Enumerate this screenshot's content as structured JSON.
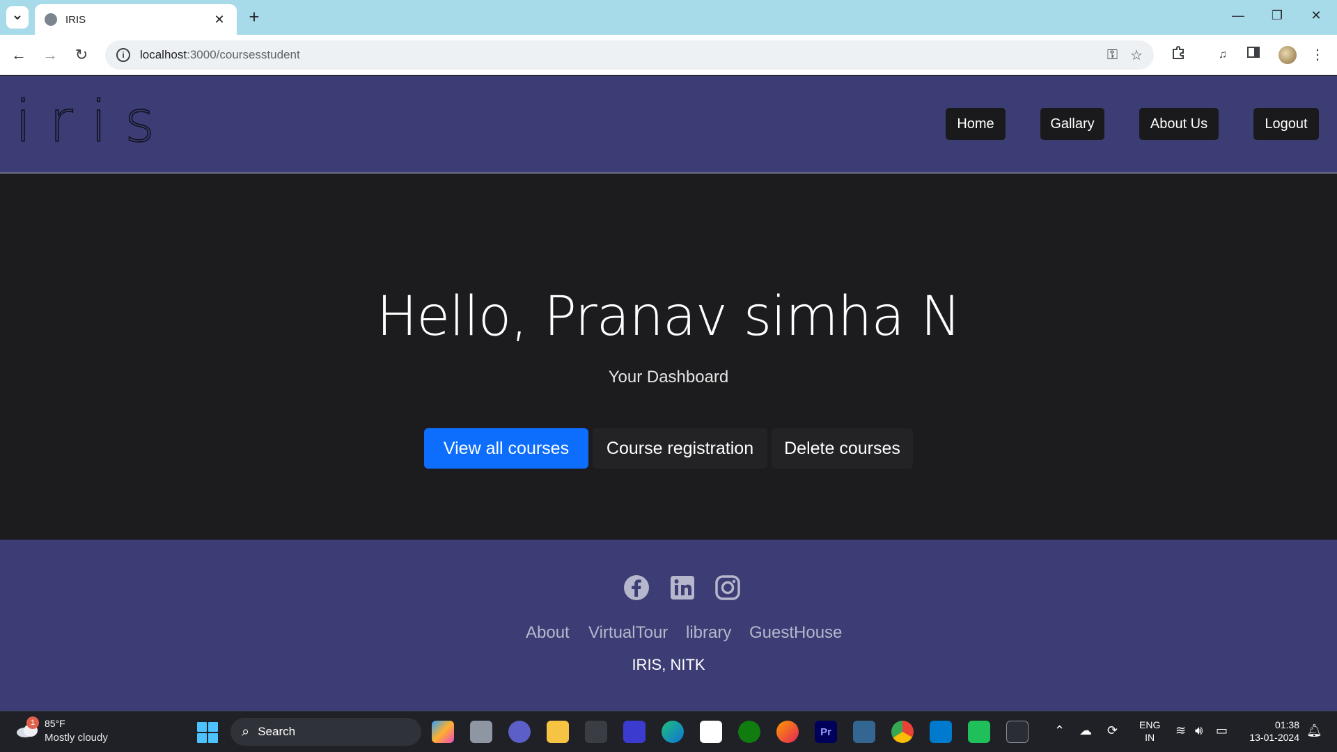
{
  "browser": {
    "tab_title": "IRIS",
    "close_glyph": "✕",
    "new_tab_glyph": "+",
    "url_host": "localhost",
    "url_path": ":3000/coursesstudent",
    "window_controls": {
      "minimize": "—",
      "maximize": "❐",
      "close": "✕"
    },
    "nav": {
      "back": "←",
      "forward": "→",
      "reload": "↻"
    }
  },
  "header": {
    "logo": "iris",
    "nav": [
      {
        "label": "Home"
      },
      {
        "label": "Gallary"
      },
      {
        "label": "About Us"
      },
      {
        "label": "Logout"
      }
    ]
  },
  "hero": {
    "title": "Hello, Pranav simha N",
    "subtitle": "Your Dashboard",
    "buttons": [
      {
        "label": "View all courses",
        "style": "primary"
      },
      {
        "label": "Course registration",
        "style": "dark"
      },
      {
        "label": "Delete courses",
        "style": "dark"
      }
    ]
  },
  "footer": {
    "social": [
      "facebook-icon",
      "linkedin-icon",
      "instagram-icon"
    ],
    "links": [
      {
        "label": "About"
      },
      {
        "label": "VirtualTour"
      },
      {
        "label": "library"
      },
      {
        "label": "GuestHouse"
      }
    ],
    "brand": "IRIS, NITK"
  },
  "taskbar": {
    "weather": {
      "badge": "1",
      "temp": "85°F",
      "desc": "Mostly cloudy"
    },
    "search_label": "Search",
    "lang_line1": "ENG",
    "lang_line2": "IN",
    "time": "01:38",
    "date": "13-01-2024"
  },
  "colors": {
    "accent": "#0d6efd",
    "header_bg": "#3c3d74",
    "hero_bg": "#1c1b1d",
    "tabstrip_bg": "#a8dbea"
  }
}
